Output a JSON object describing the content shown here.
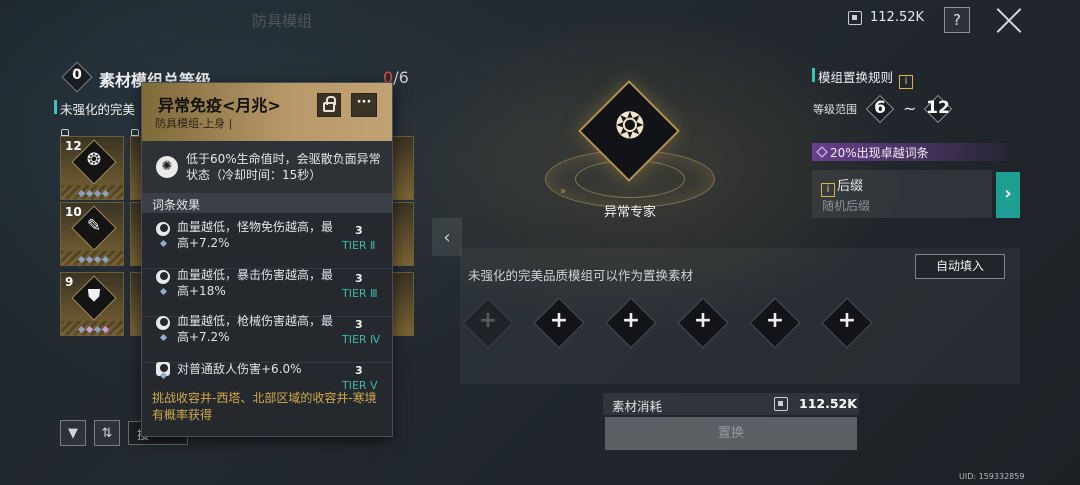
{
  "top_tabs": [
    "防具模组"
  ],
  "currency": {
    "icon": "module-currency-icon",
    "value": "112.52K"
  },
  "help_label": "?",
  "left_panel": {
    "level": "0",
    "title": "素材模组总等级",
    "count_current": "0",
    "count_max": "/6",
    "section_label": "未强化的完美",
    "tiles": [
      {
        "level": "12",
        "glyph": "❂",
        "icon": "gear-module-icon"
      },
      {
        "level": "10",
        "glyph": "✎",
        "icon": "hammer-module-icon"
      },
      {
        "level": "9",
        "glyph": "⛊",
        "icon": "armor-module-icon"
      }
    ],
    "filter_icon": "▼",
    "sort_icon": "⇅",
    "search_text": "搜"
  },
  "tooltip": {
    "name": "异常免疫<月兆>",
    "type": "防具模组-上身 |",
    "more_label": "···",
    "effect_icon": "✺",
    "effect_text": "低于60%生命值时，会驱散负面异常状态（冷却时间：15秒）",
    "section_title": "词条效果",
    "affixes": [
      {
        "text": "血量越低，怪物免伤越高，最高+7.2%",
        "value": "3",
        "tier": "TIER Ⅱ"
      },
      {
        "text": "血量越低，暴击伤害越高，最高+18%",
        "value": "3",
        "tier": "TIER Ⅲ"
      },
      {
        "text": "血量越低，枪械伤害越高，最高+7.2%",
        "value": "3",
        "tier": "TIER Ⅳ"
      },
      {
        "text": "对普通敌人伤害+6.0%",
        "value": "3",
        "tier": "TIER Ⅴ"
      }
    ],
    "source_text": "挑战收容井-西塔、北部区域的收容井-寒境有概率获得"
  },
  "center": {
    "emblem_glyph": "❂",
    "emblem_label": "异常专家",
    "arrows": "»"
  },
  "right_panel": {
    "rule_title": "模组置换规则",
    "info_icon": "i",
    "range_label": "等级范围",
    "range_min": "6",
    "range_sep": "~",
    "range_max": "12",
    "chance_text": "20%出现卓越词条",
    "suffix_title": "后缀",
    "suffix_sub": "随机后缀",
    "suffix_arrow": "›"
  },
  "lower": {
    "hint": "未强化的完美品质模组可以作为置换素材",
    "auto_fill": "自动填入",
    "slot_plus": "+",
    "cost_label": "素材消耗",
    "cost_value": "112.52K",
    "replace_label": "置换"
  },
  "uid": "UID: 159332859",
  "collapse_arrow": "‹",
  "colors": {
    "accent_teal": "#38c5b7",
    "gold": "#b8996a",
    "purple": "#6a3e8d",
    "red": "#e24a4a"
  }
}
